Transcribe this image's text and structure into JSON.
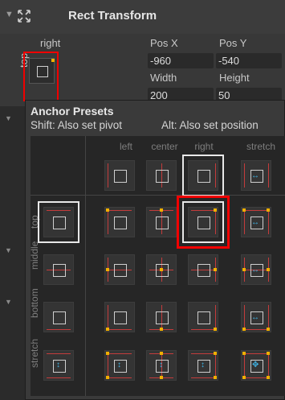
{
  "header": {
    "title": "Rect Transform"
  },
  "rect": {
    "anchor_label": "right",
    "anchor_side_label": "top",
    "pos_x_label": "Pos X",
    "pos_y_label": "Pos Y",
    "pos_x_value": "-960",
    "pos_y_value": "-540",
    "width_label": "Width",
    "height_label": "Height",
    "width_value": "200",
    "height_value": "50"
  },
  "popup": {
    "title": "Anchor Presets",
    "hint_shift": "Shift: Also set pivot",
    "hint_alt": "Alt: Also set position",
    "columns": [
      "left",
      "center",
      "right",
      "stretch"
    ],
    "rows": [
      "top",
      "middle",
      "bottom",
      "stretch"
    ],
    "selected_preset": "top-right"
  },
  "colors": {
    "accent_line": "#c43c3c",
    "pivot": "#f0b000",
    "stretch_arrow": "#3fb4e6",
    "highlight": "#f00000"
  }
}
